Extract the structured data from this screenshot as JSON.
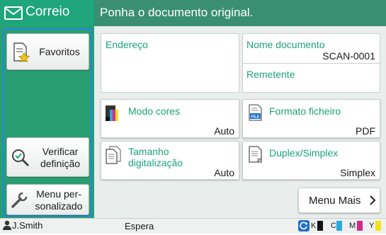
{
  "header": {
    "app_title": "Correio",
    "instruction": "Ponha o documento original."
  },
  "sidebar": {
    "favorites": "Favoritos",
    "verify_1": "Verificar",
    "verify_2": "definição",
    "custom_1": "Menu per-",
    "custom_2": "sonalizado"
  },
  "cards": {
    "address": {
      "title": "Endereço"
    },
    "doc_name": {
      "title": "Nome documento",
      "value": "SCAN-0001"
    },
    "sender": {
      "title": "Remetente"
    },
    "color_mode": {
      "title": "Modo cores",
      "value": "Auto"
    },
    "file_format": {
      "title": "Formato ficheiro",
      "value": "PDF",
      "icon_text": "FILE"
    },
    "scan_size": {
      "title_1": "Tamanho",
      "title_2": "digitalização",
      "value": "Auto"
    },
    "duplex": {
      "title": "Duplex/Simplex",
      "value": "Simplex"
    }
  },
  "more_menu": {
    "label": "Menu Mais",
    "icon": "chevron-right-icon"
  },
  "status": {
    "user": "J.Smith",
    "state": "Espera",
    "inks": [
      {
        "label": "K",
        "color": "#111111"
      },
      {
        "label": "C",
        "color": "#2aa9e0"
      },
      {
        "label": "M",
        "color": "#d6278c"
      },
      {
        "label": "Y",
        "color": "#f2e21b"
      }
    ]
  },
  "colors": {
    "accent": "#1aa37a",
    "header": "#3a8f72",
    "sidebar": "#2a9e73",
    "callout": "#1e88e5"
  }
}
